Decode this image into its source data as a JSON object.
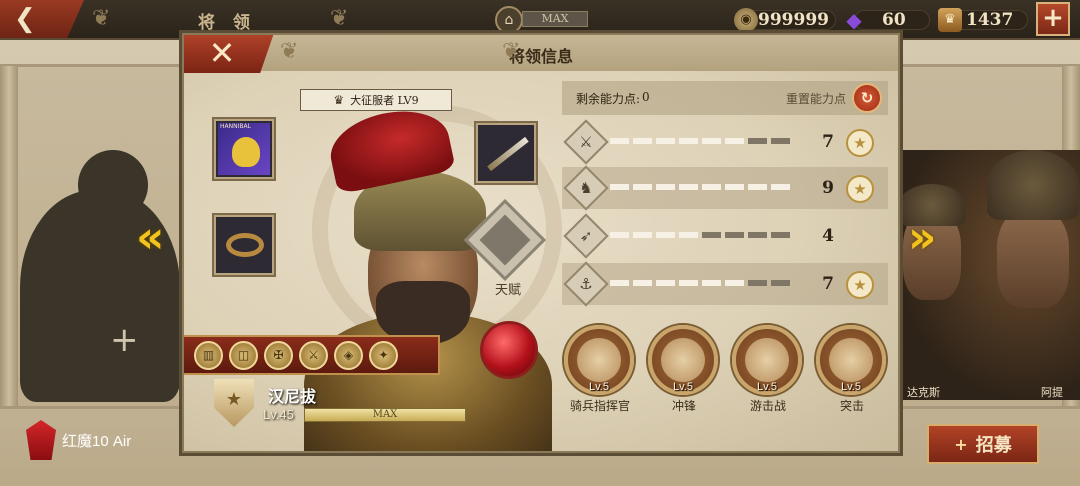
{
  "topbar": {
    "back_icon": "back-arrow-icon",
    "screen_title": "将 领",
    "capacity_text": "MAX",
    "resources": [
      {
        "icon": "coin-icon",
        "value": "999999"
      },
      {
        "icon": "purple-gem-icon",
        "value": "60"
      },
      {
        "icon": "crown-token-icon",
        "value": "1437"
      }
    ],
    "plus_label": "+"
  },
  "dialog": {
    "title": "将领信息",
    "close_label": "✕",
    "rank_badge": "大征服者 LV9",
    "talent_label": "天赋",
    "hero": {
      "name": "汉尼拔",
      "level": "Lv.45",
      "xp_text": "MAX"
    },
    "skill_medals": [
      "▥",
      "◫",
      "✠",
      "⚔",
      "◈",
      "✦"
    ],
    "stats": {
      "remaining_label": "剩余能力点:",
      "remaining_value": "0",
      "reset_label": "重置能力点",
      "rows": [
        {
          "icon": "sword-icon",
          "glyph": "⚔",
          "value": "7",
          "filled": 7,
          "has_star": true
        },
        {
          "icon": "horse-icon",
          "glyph": "♞",
          "value": "9",
          "filled": 9,
          "has_star": true
        },
        {
          "icon": "bow-icon",
          "glyph": "➶",
          "value": "4",
          "filled": 4,
          "has_star": false
        },
        {
          "icon": "anchor-icon",
          "glyph": "⚓",
          "value": "7",
          "filled": 7,
          "has_star": true
        }
      ],
      "max_points": 10
    },
    "traits": [
      {
        "level": "Lv.5",
        "name": "骑兵指挥官"
      },
      {
        "level": "Lv.5",
        "name": "冲锋"
      },
      {
        "level": "Lv.5",
        "name": "游击战"
      },
      {
        "level": "Lv.5",
        "name": "突击"
      }
    ]
  },
  "side_heroes": {
    "right_label_1": "达克斯",
    "right_label_2": "阿提"
  },
  "bottom": {
    "brand_text": "红魔10 Air",
    "recruit_label": "招募",
    "recruit_plus": "+"
  },
  "colors": {
    "accent_red": "#9a3a22",
    "gold": "#f3c31d",
    "panel_bg": "#e2d6bd"
  }
}
